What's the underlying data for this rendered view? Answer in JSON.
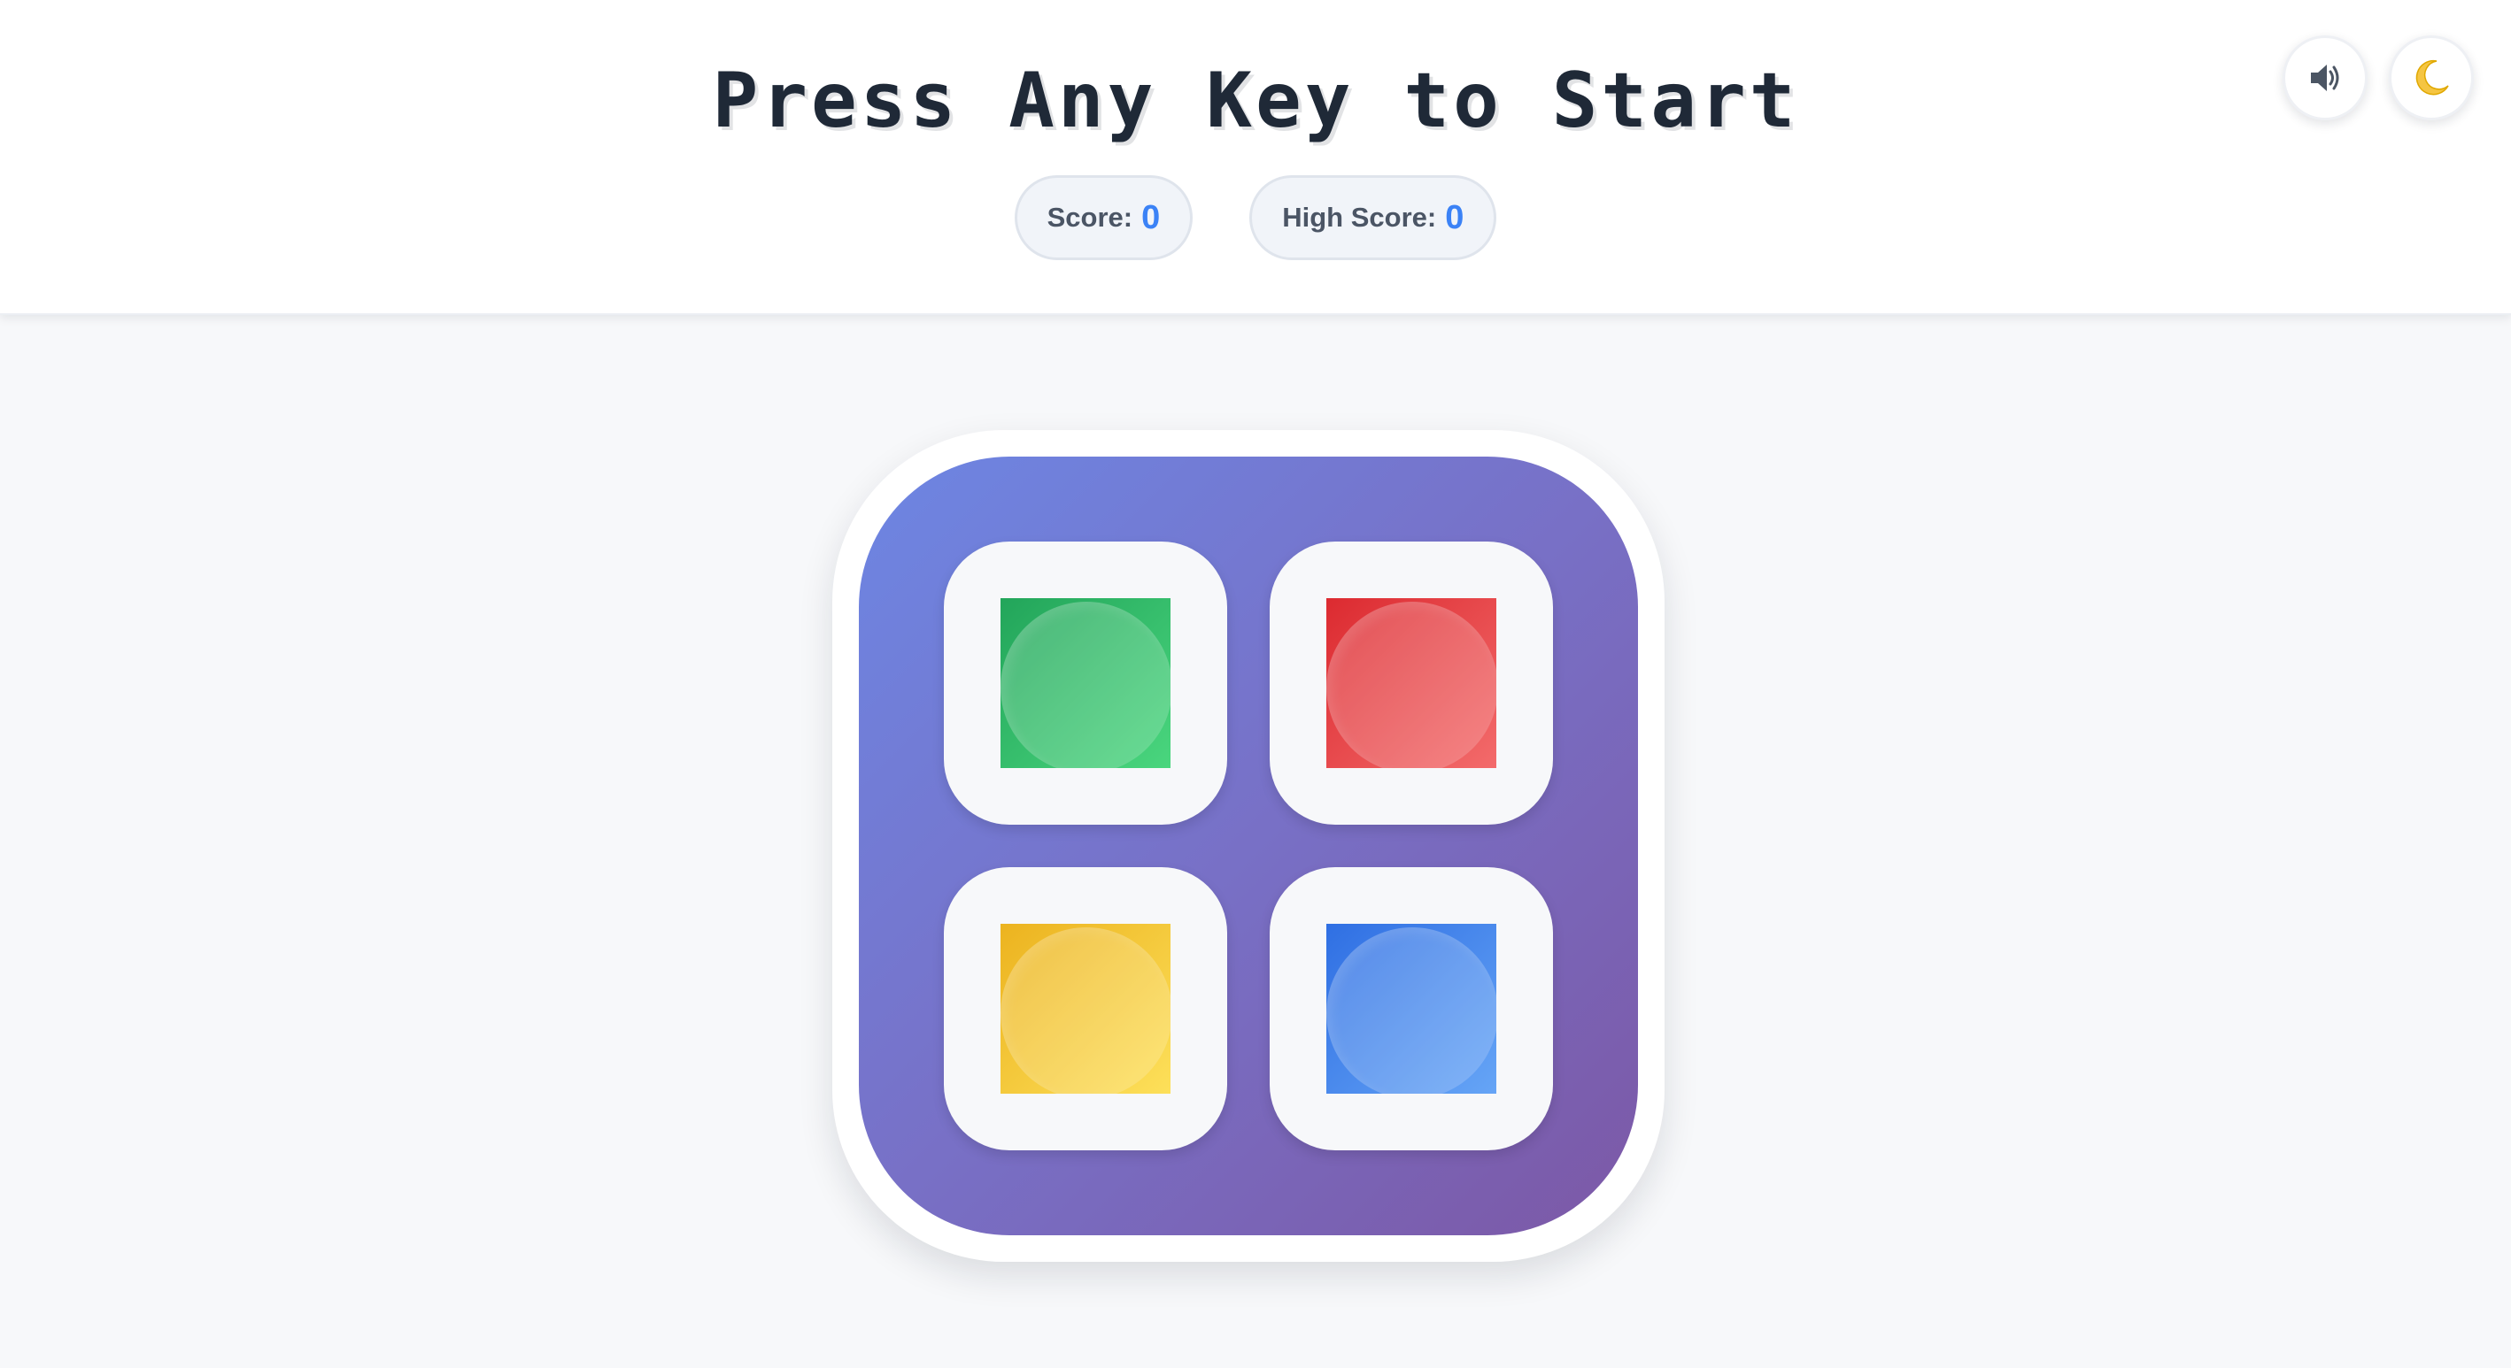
{
  "header": {
    "title": "Press Any Key to Start",
    "score_label": "Score:",
    "score_value": "0",
    "high_score_label": "High Score:",
    "high_score_value": "0",
    "sound_icon": "speaker-icon",
    "theme_icon": "moon-icon"
  },
  "board": {
    "pads": [
      {
        "color_name": "green",
        "color": "#22c55e"
      },
      {
        "color_name": "red",
        "color": "#ef4444"
      },
      {
        "color_name": "yellow",
        "color": "#facc15"
      },
      {
        "color_name": "blue",
        "color": "#3b82f6"
      }
    ],
    "background_gradient": [
      "#6d86e3",
      "#7c58a6"
    ]
  },
  "colors": {
    "accent": "#3b82f6",
    "title": "#1f2937",
    "page_bg": "#f7f8fa"
  }
}
